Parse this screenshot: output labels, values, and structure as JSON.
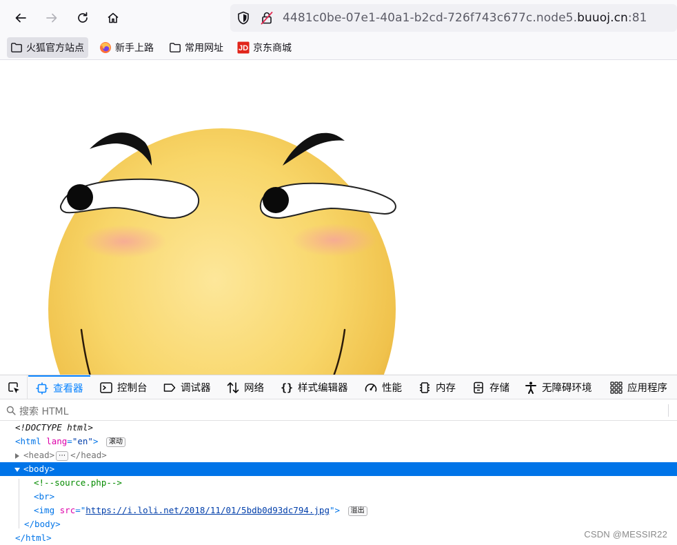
{
  "browser": {
    "url_host_prefix": "4481c0be-07e1-40a1-b2cd-726f743c677c.node5.",
    "url_host_domain": "buuoj.cn",
    "url_port": ":81"
  },
  "bookmarks": [
    {
      "label": "火狐官方站点",
      "icon": "folder-icon"
    },
    {
      "label": "新手上路",
      "icon": "firefox-icon"
    },
    {
      "label": "常用网址",
      "icon": "folder-icon"
    },
    {
      "label": "京东商城",
      "icon": "jd-icon",
      "icon_text": "JD"
    }
  ],
  "devtools": {
    "tabs": [
      {
        "label": "查看器",
        "icon": "inspector-icon",
        "selected": true
      },
      {
        "label": "控制台",
        "icon": "console-icon"
      },
      {
        "label": "调试器",
        "icon": "debugger-icon"
      },
      {
        "label": "网络",
        "icon": "network-icon"
      },
      {
        "label": "样式编辑器",
        "icon": "style-editor-icon"
      },
      {
        "label": "性能",
        "icon": "performance-icon"
      },
      {
        "label": "内存",
        "icon": "memory-icon"
      },
      {
        "label": "存储",
        "icon": "storage-icon"
      },
      {
        "label": "无障碍环境",
        "icon": "accessibility-icon"
      },
      {
        "label": "应用程序",
        "icon": "application-icon"
      }
    ],
    "search_placeholder": "搜索 HTML",
    "tree": {
      "doctype": "<!DOCTYPE html>",
      "html_open": "<html",
      "html_attr": "lang",
      "html_attr_val": "\"en\"",
      "html_close_bracket": ">",
      "html_badge": "滚动",
      "head_open": "<head>",
      "head_ellipsis": "⋯",
      "head_close": "</head>",
      "body_open": "<body>",
      "comment": "<!--source.php-->",
      "br": "<br>",
      "img_open": "<img",
      "img_attr": "src",
      "img_eq": "=\"",
      "img_src": "https://i.loli.net/2018/11/01/5bdb0d93dc794.jpg",
      "img_end": "\">",
      "img_badge": "溢出",
      "body_close": "</body>",
      "html_close": "</html>"
    }
  },
  "watermark": "CSDN @MESSIR22",
  "colors": {
    "accent": "#0a84ff",
    "selection": "#0074e8",
    "tag": "#0074e8",
    "attr": "#dd00a9",
    "comment": "#058b00"
  }
}
